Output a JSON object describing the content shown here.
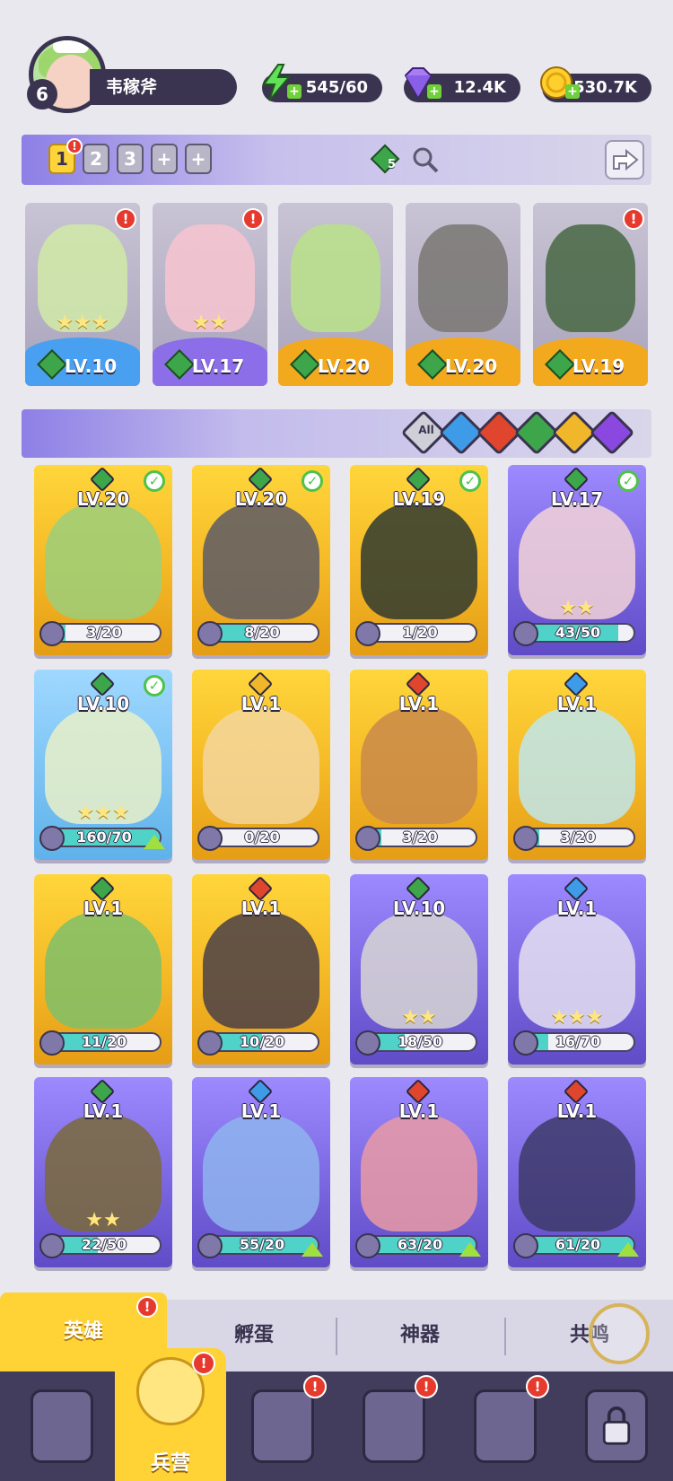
{
  "player": {
    "level": "6",
    "name": "韦稼斧"
  },
  "resources": {
    "energy": "545/60",
    "gems": "12.4K",
    "gold": "530.7K"
  },
  "team": {
    "slots": [
      "1",
      "2",
      "3",
      "+",
      "+"
    ],
    "active_slot": "1",
    "gem_count": "5",
    "alert": "!"
  },
  "team_heroes": [
    {
      "level": "LV.10",
      "stars": "★★★",
      "band_color": "#4aa0f0",
      "art_color": "#cfe7a8",
      "alert": "!"
    },
    {
      "level": "LV.17",
      "stars": "★★",
      "band_color": "#8b6ee8",
      "art_color": "#f4c3cf",
      "alert": "!"
    },
    {
      "level": "LV.20",
      "stars": "",
      "band_color": "#f2a91e",
      "art_color": "#b9e08c",
      "alert": ""
    },
    {
      "level": "LV.20",
      "stars": "",
      "band_color": "#f2a91e",
      "art_color": "#7d7a78",
      "alert": ""
    },
    {
      "level": "LV.19",
      "stars": "",
      "band_color": "#f2a91e",
      "art_color": "#4e6b4a",
      "alert": "!"
    }
  ],
  "filters": [
    {
      "label": "All",
      "color": "#cfcfd8"
    },
    {
      "label": "",
      "color": "#3e9be8"
    },
    {
      "label": "",
      "color": "#e0452e"
    },
    {
      "label": "",
      "color": "#3ea64a"
    },
    {
      "label": "",
      "color": "#f0b72a"
    },
    {
      "label": "",
      "color": "#8a48e0"
    }
  ],
  "heroes": [
    {
      "level": "LV.20",
      "cards": "3/20",
      "progress": 0.15,
      "bg": "gold",
      "elem": "#3ea64a",
      "art": "#9bcf7a",
      "check": true,
      "upgrade": false,
      "stars": ""
    },
    {
      "level": "LV.20",
      "cards": "8/20",
      "progress": 0.4,
      "bg": "gold",
      "elem": "#3ea64a",
      "art": "#5c5a66",
      "check": true,
      "upgrade": false,
      "stars": ""
    },
    {
      "level": "LV.19",
      "cards": "1/20",
      "progress": 0.05,
      "bg": "gold",
      "elem": "#3ea64a",
      "art": "#2f3a30",
      "check": true,
      "upgrade": false,
      "stars": ""
    },
    {
      "level": "LV.17",
      "cards": "43/50",
      "progress": 0.86,
      "bg": "purple",
      "elem": "#3ea64a",
      "art": "#f3d3d8",
      "check": true,
      "upgrade": false,
      "stars": "★★"
    },
    {
      "level": "LV.10",
      "cards": "160/70",
      "progress": 1.0,
      "bg": "blue",
      "elem": "#3ea64a",
      "art": "#e9f0c8",
      "check": true,
      "upgrade": true,
      "stars": "★★★"
    },
    {
      "level": "LV.1",
      "cards": "0/20",
      "progress": 0.0,
      "bg": "gold",
      "elem": "#f0b72a",
      "art": "#f3d69c",
      "check": false,
      "upgrade": false,
      "stars": ""
    },
    {
      "level": "LV.1",
      "cards": "3/20",
      "progress": 0.15,
      "bg": "gold",
      "elem": "#e0452e",
      "art": "#c98a4a",
      "check": false,
      "upgrade": false,
      "stars": ""
    },
    {
      "level": "LV.1",
      "cards": "3/20",
      "progress": 0.15,
      "bg": "gold",
      "elem": "#3e9be8",
      "art": "#bfe6ec",
      "check": false,
      "upgrade": false,
      "stars": ""
    },
    {
      "level": "LV.1",
      "cards": "11/20",
      "progress": 0.55,
      "bg": "gold",
      "elem": "#3ea64a",
      "art": "#7fbf6a",
      "check": false,
      "upgrade": false,
      "stars": ""
    },
    {
      "level": "LV.1",
      "cards": "10/20",
      "progress": 0.5,
      "bg": "gold",
      "elem": "#e0452e",
      "art": "#4a4048",
      "check": false,
      "upgrade": false,
      "stars": ""
    },
    {
      "level": "LV.10",
      "cards": "18/50",
      "progress": 0.36,
      "bg": "purple",
      "elem": "#3ea64a",
      "art": "#d8d6d4",
      "check": false,
      "upgrade": false,
      "stars": "★★"
    },
    {
      "level": "LV.1",
      "cards": "16/70",
      "progress": 0.23,
      "bg": "purple",
      "elem": "#3e9be8",
      "art": "#e4dff0",
      "check": false,
      "upgrade": false,
      "stars": "★★★"
    },
    {
      "level": "LV.1",
      "cards": "22/50",
      "progress": 0.44,
      "bg": "purple",
      "elem": "#3ea64a",
      "art": "#7a6a3a",
      "check": false,
      "upgrade": false,
      "stars": "★★"
    },
    {
      "level": "LV.1",
      "cards": "55/20",
      "progress": 1.0,
      "bg": "purple",
      "elem": "#3e9be8",
      "art": "#8fb4ee",
      "check": false,
      "upgrade": true,
      "stars": ""
    },
    {
      "level": "LV.1",
      "cards": "63/20",
      "progress": 1.0,
      "bg": "purple",
      "elem": "#e0452e",
      "art": "#e99aa4",
      "check": false,
      "upgrade": true,
      "stars": ""
    },
    {
      "level": "LV.1",
      "cards": "61/20",
      "progress": 1.0,
      "bg": "purple",
      "elem": "#e0452e",
      "art": "#3d3a6a",
      "check": false,
      "upgrade": true,
      "stars": ""
    }
  ],
  "subtabs": [
    {
      "label": "英雄",
      "active": true,
      "alert": "!"
    },
    {
      "label": "孵蛋",
      "active": false,
      "alert": ""
    },
    {
      "label": "神器",
      "active": false,
      "alert": ""
    },
    {
      "label": "共鸣",
      "active": false,
      "alert": ""
    }
  ],
  "bottom_nav": [
    {
      "label": "",
      "icon": "cards-icon",
      "alert": ""
    },
    {
      "label": "兵营",
      "icon": "barracks-icon",
      "alert": "!",
      "active": true
    },
    {
      "label": "",
      "icon": "map-book-icon",
      "alert": "!"
    },
    {
      "label": "",
      "icon": "temple-icon",
      "alert": "!"
    },
    {
      "label": "",
      "icon": "guild-icon",
      "alert": "!"
    },
    {
      "label": "",
      "icon": "locked-icon",
      "alert": ""
    }
  ]
}
